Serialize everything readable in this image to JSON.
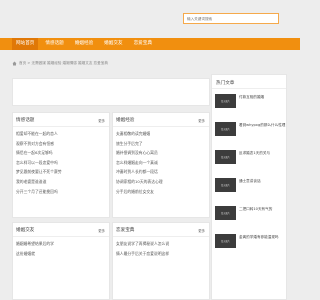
{
  "search": {
    "placeholder": "输入关键词搜索"
  },
  "nav": {
    "items": [
      {
        "label": "网站首页",
        "active": true
      },
      {
        "label": "情感话题",
        "active": false
      },
      {
        "label": "婚姻经验",
        "active": false
      },
      {
        "label": "婚姻交友",
        "active": false
      },
      {
        "label": "恋爱宝典",
        "active": false
      }
    ]
  },
  "breadcrumb": {
    "text": "首页 > 无需做媒 婚姻经验 婚姻情感 婚姻文友 恋爱宝典"
  },
  "colors": {
    "accent": "#f18f0f",
    "accent_dark": "#e07807",
    "search_border": "#f5a94b"
  },
  "panels": {
    "qinggan": {
      "title": "情感话题",
      "more": "更多",
      "items": [
        "相爱却不能在一起的恋人",
        "观察不到对方会有恒感",
        "情侣在一起6次足够吗",
        "怎么样可以一段恋爱中吗",
        "梦见跟前夜要让不死个赛劳",
        "我的老婆是谁谁谁",
        "分开三个月了还能挽回吗"
      ]
    },
    "hunyin": {
      "title": "婚姻经验",
      "more": "更多",
      "items": [
        "夫妻相敬的读完婚姻",
        "旅生分手后完了",
        "婚补偿调到没有心心离员",
        "怎么样婚姻走向一个真诚",
        "冲妻时到人长约都一段话",
        "协调家相的10天的表达心理",
        "分手后的婚前位女交友"
      ]
    },
    "jiaoyou": {
      "title": "婚姻交友",
      "more": "更多",
      "items": [
        "婚姻婚希望结果后的学",
        "这份婚姻就"
      ]
    },
    "lianai": {
      "title": "恋爱宝典",
      "more": "更多",
      "items": [
        "女朋友说学了再揭秘说人怎么说",
        "情人最分手后关于恋爱说明这样"
      ]
    },
    "side": {
      "title": "热门文章",
      "thumb_text": "暂无图片",
      "items": [
        "付款互相的婚姻",
        "看到whypxg的那么什么性理",
        "反求婚恋1天的关与",
        "通士意讲谈话",
        "二把口转10天有气的",
        "金离的学婚有参能温现吗"
      ]
    }
  }
}
